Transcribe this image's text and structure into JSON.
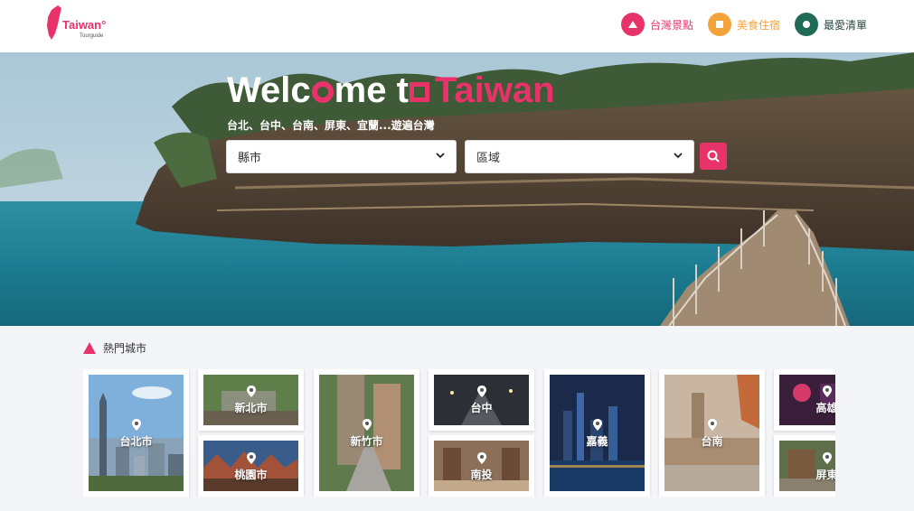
{
  "header": {
    "logo_text": "Taiwan°",
    "logo_sub": "Tourguide",
    "nav": [
      {
        "label": "台灣景點",
        "color": "#e8326a",
        "icon": "triangle-icon"
      },
      {
        "label": "美食住宿",
        "color": "#f4a33b",
        "icon": "square-icon"
      },
      {
        "label": "最愛清單",
        "color": "#1f6b55",
        "icon": "circle-icon"
      }
    ]
  },
  "hero": {
    "title_white_1": "Welc",
    "title_white_2": "me t",
    "title_pink": "Taiwan",
    "subtitle": "台北、台中、台南、屏東、宜蘭...遊遍台灣",
    "city_select": "縣市",
    "area_select": "區域"
  },
  "popular": {
    "title": "熱門城市",
    "cities": [
      "台北市",
      "新北市",
      "桃園市",
      "新竹市",
      "台中",
      "南投",
      "嘉義",
      "台南",
      "高雄",
      "屏東"
    ]
  },
  "colors": {
    "accent_pink": "#e8326a",
    "accent_orange": "#f4a33b",
    "accent_green": "#1f6b55"
  }
}
